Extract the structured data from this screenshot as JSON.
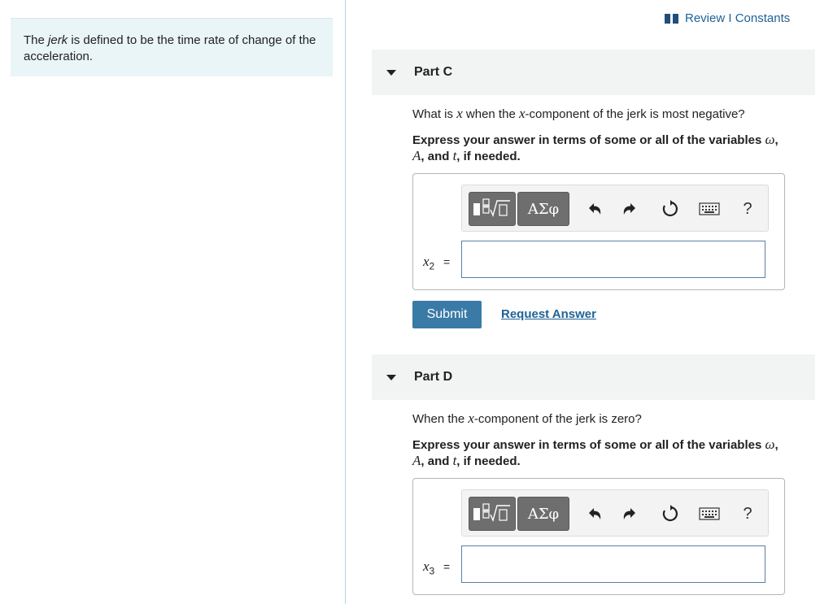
{
  "intro": {
    "text_before": "The ",
    "jerk_word": "jerk",
    "text_after": " is defined to be the time rate of change of the acceleration."
  },
  "header": {
    "review_label": "Review",
    "separator": "I",
    "constants_label": "Constants",
    "link_color": "#1f6296"
  },
  "toolbar": {
    "greek_label": "ΑΣφ",
    "help_label": "?",
    "icons": [
      "templates-icon",
      "greek-letters-icon",
      "undo-icon",
      "redo-icon",
      "reset-icon",
      "keyboard-icon",
      "help-icon"
    ]
  },
  "parts": [
    {
      "title": "Part C",
      "question": {
        "p1": "What is ",
        "v1": "x",
        "p2": " when the ",
        "v2": "x",
        "p3": "-component of the jerk is most negative?"
      },
      "instruction": {
        "p1": "Express your answer in terms of some or all of the variables ",
        "omega": "ω",
        "comma": ",",
        "A": "A",
        "and": ", and ",
        "t": "t",
        "tail": ", if needed."
      },
      "answer_label": {
        "var": "x",
        "sub": "2",
        "eq": "="
      },
      "answer_value": ""
    },
    {
      "title": "Part D",
      "question": {
        "p1": "When the ",
        "v1": "x",
        "p2": "-component of the jerk is zero?"
      },
      "instruction": {
        "p1": "Express your answer in terms of some or all of the variables ",
        "omega": "ω",
        "comma": ",",
        "A": "A",
        "and": ", and ",
        "t": "t",
        "tail": ", if needed."
      },
      "answer_label": {
        "var": "x",
        "sub": "3",
        "eq": "="
      },
      "answer_value": ""
    }
  ],
  "actions": {
    "submit_label": "Submit",
    "request_answer_label": "Request Answer",
    "submit_color": "#3a7aa6"
  }
}
